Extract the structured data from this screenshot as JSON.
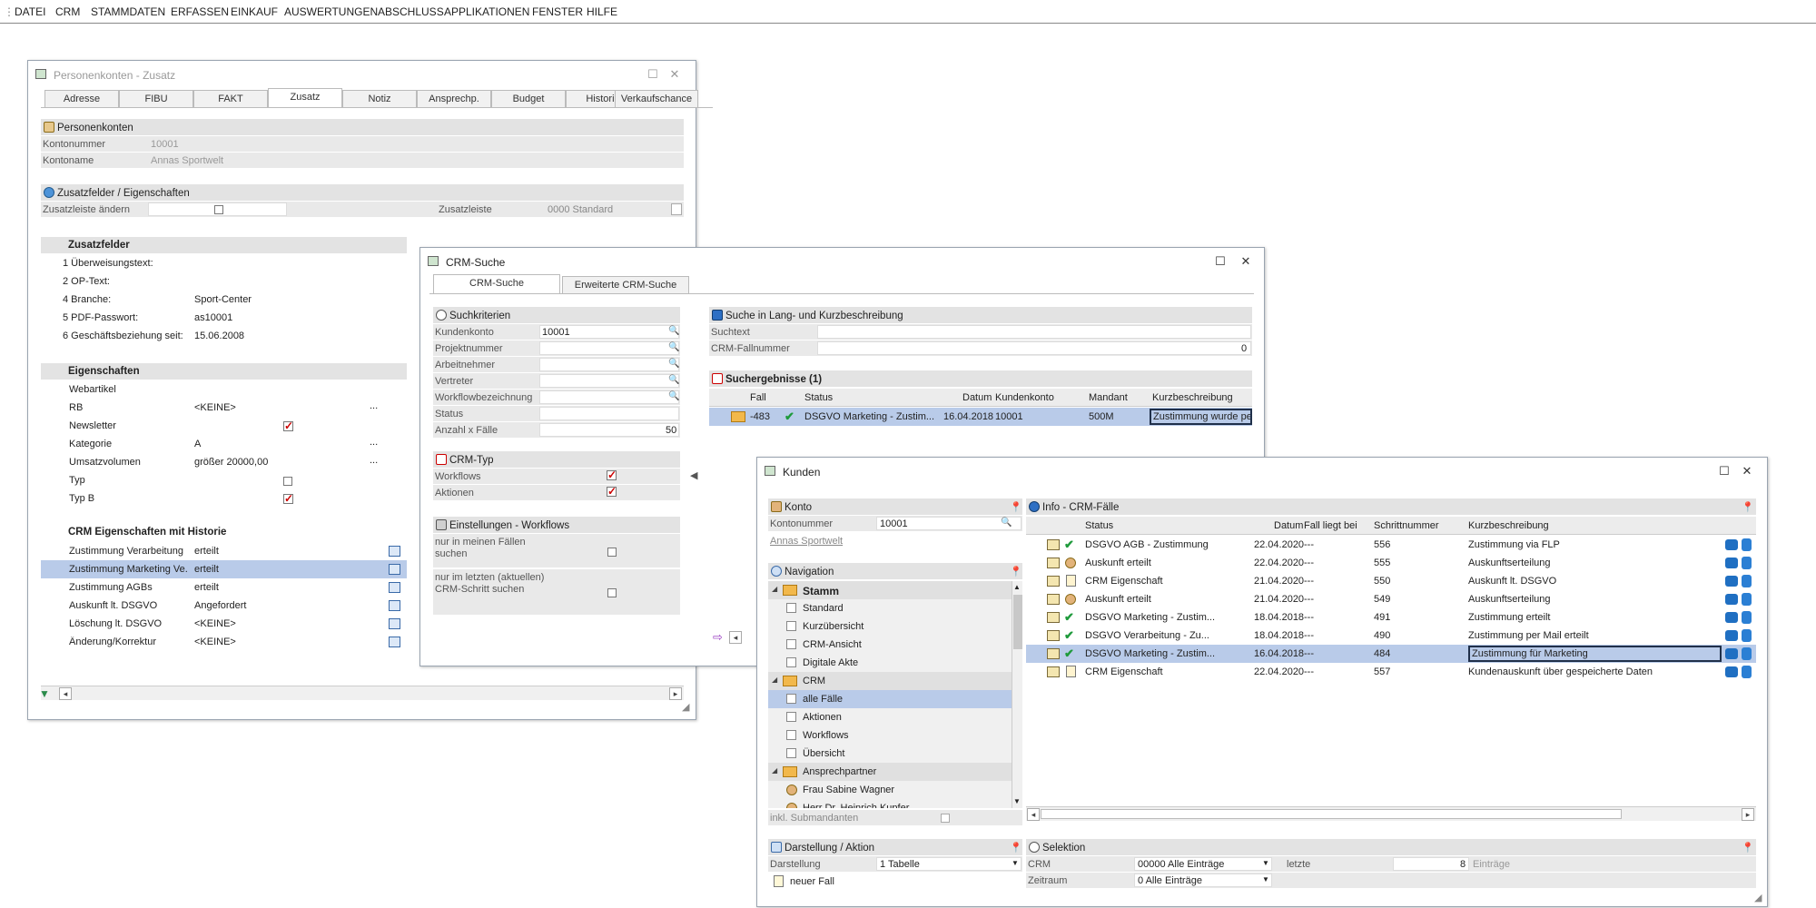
{
  "menu": [
    "DATEI",
    "CRM",
    "STAMMDATEN",
    "ERFASSEN",
    "EINKAUF",
    "AUSWERTUNGEN",
    "ABSCHLUSS",
    "APPLIKATIONEN",
    "FENSTER",
    "HILFE"
  ],
  "pk": {
    "title": "Personenkonten - Zusatz",
    "tabs": [
      "Adresse",
      "FIBU",
      "FAKT",
      "Zusatz",
      "Notiz",
      "Ansprechp.",
      "Budget",
      "Historie",
      "Verkaufschance"
    ],
    "sec_personenkonten": "Personenkonten",
    "kontonummer_label": "Kontonummer",
    "kontonummer": "10001",
    "kontoname_label": "Kontoname",
    "kontoname": "Annas Sportwelt",
    "sec_zusatzfelder": "Zusatzfelder / Eigenschaften",
    "zusatzleiste_aendern": "Zusatzleiste ändern",
    "zusatzleiste_label": "Zusatzleiste",
    "zusatzleiste_value": "0000 Standard",
    "zf_header": "Zusatzfelder",
    "zf_rows": [
      {
        "k": "1 Überweisungstext:",
        "v": ""
      },
      {
        "k": "2 OP-Text:",
        "v": ""
      },
      {
        "k": "4 Branche:",
        "v": "Sport-Center"
      },
      {
        "k": "5 PDF-Passwort:",
        "v": "as10001"
      },
      {
        "k": "6 Geschäftsbeziehung seit:",
        "v": "15.06.2008"
      }
    ],
    "eig_header": "Eigenschaften",
    "eig_rows": [
      {
        "k": "Webartikel",
        "v": ""
      },
      {
        "k": "RB",
        "v": "<KEINE>"
      },
      {
        "k": "Newsletter",
        "v": ""
      },
      {
        "k": "Kategorie",
        "v": "A"
      },
      {
        "k": "Umsatzvolumen",
        "v": "größer 20000,00"
      },
      {
        "k": "Typ",
        "v": ""
      },
      {
        "k": "Typ B",
        "v": ""
      }
    ],
    "more": "...",
    "hist_header": "CRM Eigenschaften mit Historie",
    "hist_rows": [
      {
        "k": "Zustimmung Verarbeitung",
        "v": "erteilt"
      },
      {
        "k": "Zustimmung Marketing Ve...",
        "v": "erteilt"
      },
      {
        "k": "Zustimmung AGBs",
        "v": "erteilt"
      },
      {
        "k": "Auskunft lt. DSGVO",
        "v": "Angefordert"
      },
      {
        "k": "Löschung lt. DSGVO",
        "v": "<KEINE>"
      },
      {
        "k": "Änderung/Korrektur",
        "v": "<KEINE>"
      }
    ]
  },
  "crm": {
    "title": "CRM-Suche",
    "tabs": [
      "CRM-Suche",
      "Erweiterte CRM-Suche"
    ],
    "sec_kriterien": "Suchkriterien",
    "kriterien": [
      {
        "k": "Kundenkonto",
        "v": "10001"
      },
      {
        "k": "Projektnummer",
        "v": ""
      },
      {
        "k": "Arbeitnehmer",
        "v": ""
      },
      {
        "k": "Vertreter",
        "v": ""
      },
      {
        "k": "Workflowbezeichnung",
        "v": ""
      },
      {
        "k": "Status",
        "v": ""
      },
      {
        "k": "Anzahl x Fälle",
        "v": "50"
      }
    ],
    "sec_typ": "CRM-Typ",
    "typ_rows": [
      "Workflows",
      "Aktionen"
    ],
    "sec_einst": "Einstellungen - Workflows",
    "einst_1": "nur in meinen Fällen suchen",
    "einst_2": "nur im letzten (aktuellen) CRM-Schritt suchen",
    "sec_lang": "Suche in Lang- und Kurzbeschreibung",
    "suchtext_label": "Suchtext",
    "fallnummer_label": "CRM-Fallnummer",
    "fallnummer": "0",
    "sec_ergebnisse": "Suchergebnisse (1)",
    "cols": [
      "Fall",
      "Status",
      "Datum",
      "Kundenkonto",
      "Mandant",
      "Kurzbeschreibung"
    ],
    "result": {
      "fall": "-483",
      "status": "DSGVO Marketing - Zustim...",
      "datum": "16.04.2018",
      "konto": "10001",
      "mandant": "500M",
      "kurz": "Zustimmung wurde per"
    }
  },
  "kunden": {
    "title": "Kunden",
    "sec_konto": "Konto",
    "kontonummer_label": "Kontonummer",
    "kontonummer": "10001",
    "kontoname": "Annas Sportwelt",
    "sec_nav": "Navigation",
    "nav": [
      {
        "label": "Stamm",
        "type": "group"
      },
      {
        "label": "Standard",
        "type": "item"
      },
      {
        "label": "Kurzübersicht",
        "type": "item"
      },
      {
        "label": "CRM-Ansicht",
        "type": "item"
      },
      {
        "label": "Digitale Akte",
        "type": "item"
      },
      {
        "label": "CRM",
        "type": "group2"
      },
      {
        "label": "alle Fälle",
        "type": "item"
      },
      {
        "label": "Aktionen",
        "type": "item"
      },
      {
        "label": "Workflows",
        "type": "item"
      },
      {
        "label": "Übersicht",
        "type": "item"
      },
      {
        "label": "Ansprechpartner",
        "type": "group2"
      },
      {
        "label": "Frau Sabine Wagner",
        "type": "person"
      },
      {
        "label": "Herr Dr. Heinrich Kupfer",
        "type": "person"
      }
    ],
    "inkl_sub": "inkl. Submandanten",
    "sec_info": "Info - CRM-Fälle",
    "cols": [
      "Status",
      "Datum",
      "Fall liegt bei",
      "Schrittnummer",
      "Kurzbeschreibung"
    ],
    "rows": [
      {
        "status": "DSGVO AGB - Zustimmung",
        "datum": "22.04.2020",
        "bei": "---",
        "schritt": "556",
        "kurz": "Zustimmung via FLP",
        "icon": "ok"
      },
      {
        "status": "Auskunft erteilt",
        "datum": "22.04.2020",
        "bei": "---",
        "schritt": "555",
        "kurz": "Auskunftserteilung",
        "icon": "user"
      },
      {
        "status": "CRM Eigenschaft",
        "datum": "21.04.2020",
        "bei": "---",
        "schritt": "550",
        "kurz": "Auskunft lt. DSGVO",
        "icon": "doc"
      },
      {
        "status": "Auskunft erteilt",
        "datum": "21.04.2020",
        "bei": "---",
        "schritt": "549",
        "kurz": "Auskunftserteilung",
        "icon": "user"
      },
      {
        "status": "DSGVO Marketing - Zustim...",
        "datum": "18.04.2018",
        "bei": "---",
        "schritt": "491",
        "kurz": "Zustimmung erteilt",
        "icon": "ok"
      },
      {
        "status": "DSGVO Verarbeitung - Zu...",
        "datum": "18.04.2018",
        "bei": "---",
        "schritt": "490",
        "kurz": "Zustimmung per Mail erteilt",
        "icon": "ok"
      },
      {
        "status": "DSGVO Marketing - Zustim...",
        "datum": "16.04.2018",
        "bei": "---",
        "schritt": "484",
        "kurz": "Zustimmung für Marketing",
        "icon": "ok"
      },
      {
        "status": "CRM Eigenschaft",
        "datum": "22.04.2020",
        "bei": "---",
        "schritt": "557",
        "kurz": "Kundenauskunft über gespeicherte Daten",
        "icon": "doc"
      }
    ],
    "sec_darst": "Darstellung / Aktion",
    "darstellung_label": "Darstellung",
    "darstellung_value": "1 Tabelle",
    "neuer_fall": "neuer Fall",
    "sec_selektion": "Selektion",
    "crm_label": "CRM",
    "crm_value": "00000 Alle Einträge",
    "letzte_label": "letzte",
    "letzte_value": "8",
    "eintraege": "Einträge",
    "zeitraum_label": "Zeitraum",
    "zeitraum_value": "0 Alle Einträge"
  }
}
